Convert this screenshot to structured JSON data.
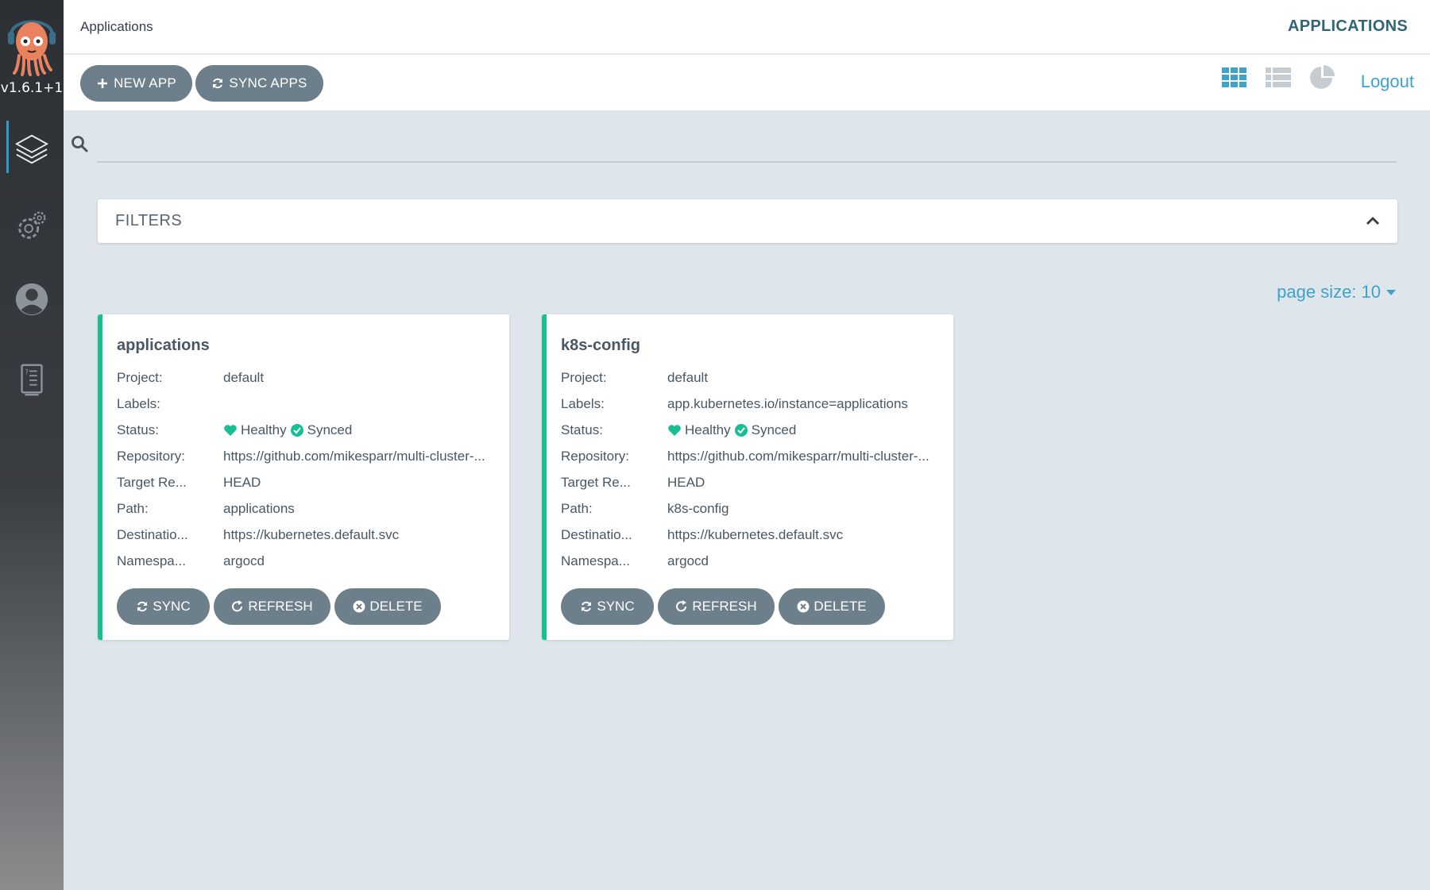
{
  "sidebar": {
    "version": "v1.6.1+1",
    "items": [
      {
        "name": "applications",
        "icon": "layers-icon",
        "active": true
      },
      {
        "name": "settings",
        "icon": "gear-icon"
      },
      {
        "name": "user-info",
        "icon": "user-icon"
      },
      {
        "name": "documentation",
        "icon": "docs-icon"
      }
    ]
  },
  "header": {
    "breadcrumb": "Applications",
    "title": "APPLICATIONS"
  },
  "toolbar": {
    "new_app": "NEW APP",
    "sync_apps": "SYNC APPS",
    "logout": "Logout",
    "views": [
      "tiles-view-icon",
      "list-view-icon",
      "summary-view-icon"
    ]
  },
  "search": {
    "placeholder": "",
    "value": ""
  },
  "filters": {
    "label": "FILTERS"
  },
  "pagination": {
    "page_size": "page size: 10"
  },
  "fields": {
    "project": "Project:",
    "labels": "Labels:",
    "status": "Status:",
    "repository": "Repository:",
    "target": "Target Re...",
    "path": "Path:",
    "destination": "Destinatio...",
    "namespace": "Namespa..."
  },
  "apps": [
    {
      "name": "applications",
      "project": "default",
      "labels": "",
      "health": "Healthy",
      "sync": "Synced",
      "repository": "https://github.com/mikesparr/multi-cluster-...",
      "target": "HEAD",
      "path": "applications",
      "destination": "https://kubernetes.default.svc",
      "namespace": "argocd"
    },
    {
      "name": "k8s-config",
      "project": "default",
      "labels": "app.kubernetes.io/instance=applications",
      "health": "Healthy",
      "sync": "Synced",
      "repository": "https://github.com/mikesparr/multi-cluster-...",
      "target": "HEAD",
      "path": "k8s-config",
      "destination": "https://kubernetes.default.svc",
      "namespace": "argocd"
    }
  ],
  "card_actions": {
    "sync": "SYNC",
    "refresh": "REFRESH",
    "delete": "DELETE"
  },
  "colors": {
    "accent": "#3ea3c9",
    "healthy": "#18be94",
    "button": "#6d7f8b",
    "title": "#2f6675"
  }
}
